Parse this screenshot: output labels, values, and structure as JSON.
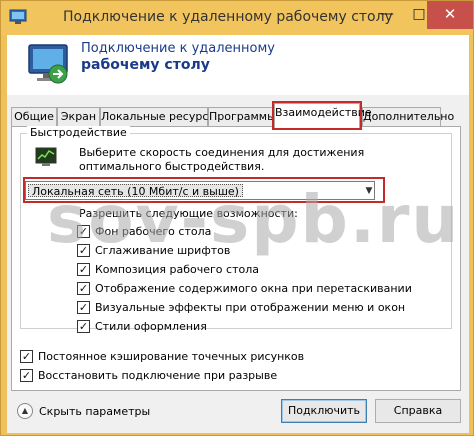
{
  "window": {
    "title": "Подключение к удаленному рабочему столу",
    "minimize": "—",
    "maximize": "□",
    "close": "✕"
  },
  "header": {
    "line1": "Подключение к удаленному",
    "line2": "рабочему столу"
  },
  "tabs": [
    {
      "label": "Общие"
    },
    {
      "label": "Экран"
    },
    {
      "label": "Локальные ресурсы"
    },
    {
      "label": "Программы"
    },
    {
      "label": "Взаимодействие",
      "active": true
    },
    {
      "label": "Дополнительно"
    }
  ],
  "performance": {
    "group_label": "Быстродействие",
    "description": "Выберите скорость соединения для достижения оптимального быстродействия.",
    "speed_selected": "Локальная сеть (10 Мбит/с и выше)",
    "allow_label": "Разрешить следующие возможности:",
    "options": [
      {
        "label": "Фон рабочего стола",
        "checked": true
      },
      {
        "label": "Сглаживание шрифтов",
        "checked": true
      },
      {
        "label": "Композиция рабочего стола",
        "checked": true
      },
      {
        "label": "Отображение содержимого окна при перетаскивании",
        "checked": true
      },
      {
        "label": "Визуальные эффекты при отображении меню и окон",
        "checked": true
      },
      {
        "label": "Стили оформления",
        "checked": true
      }
    ]
  },
  "persistent_cache": {
    "label": "Постоянное кэширование точечных рисунков",
    "checked": true
  },
  "reconnect": {
    "label": "Восстановить подключение при разрыве",
    "checked": true
  },
  "footer": {
    "hide_options": "Скрыть параметры",
    "connect": "Подключить",
    "help": "Справка"
  },
  "watermark": "sov-spb.ru",
  "colors": {
    "accent_outline": "#c52a2a",
    "window_frame": "#f2c45e"
  }
}
